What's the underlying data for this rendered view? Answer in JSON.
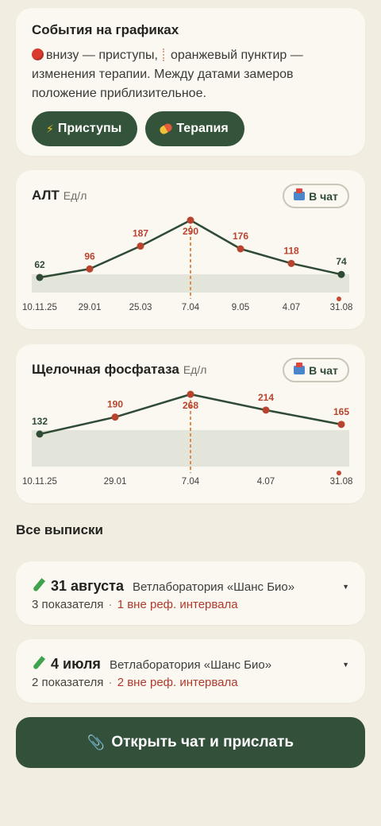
{
  "events": {
    "title": "События на графиках",
    "line1_a": "внизу — приступы,",
    "line1_b": "оранжевый пунктир —",
    "line2": "изменения терапии. Между датами замеров",
    "line3": "положение приблизительное.",
    "chips": [
      {
        "label": "Приступы",
        "icon": "lightning-icon"
      },
      {
        "label": "Терапия",
        "icon": "pill-icon"
      }
    ]
  },
  "chart_data": [
    {
      "type": "line",
      "title": "АЛТ",
      "unit": "Ед/л",
      "chat_label": "В чат",
      "x": [
        "10.11.25",
        "29.01",
        "25.03",
        "7.04",
        "9.05",
        "4.07",
        "31.08"
      ],
      "values": [
        62,
        96,
        187,
        290,
        176,
        118,
        74
      ],
      "ref_range_shaded": true,
      "therapy_change_at": "7.04",
      "seizure_marker_at": "31.08",
      "colors": {
        "line": "#2f4b36",
        "point_out_of_range": "#b8432f",
        "point_normal": "#2f4b36",
        "ref_band": "#e3e5da",
        "therapy_line": "#e08a4b"
      }
    },
    {
      "type": "line",
      "title": "Щелочная фосфатаза",
      "unit": "Ед/л",
      "chat_label": "В чат",
      "x": [
        "10.11.25",
        "29.01",
        "7.04",
        "4.07",
        "31.08"
      ],
      "values": [
        132,
        190,
        268,
        214,
        165
      ],
      "ref_range_shaded": true,
      "therapy_change_at": "7.04",
      "seizure_marker_at": "31.08",
      "colors": {
        "line": "#2f4b36",
        "point_out_of_range": "#b8432f",
        "point_normal": "#2f4b36",
        "ref_band": "#e3e5da",
        "therapy_line": "#e08a4b"
      }
    }
  ],
  "records": {
    "title": "Все выписки",
    "items": [
      {
        "date": "31 августа",
        "lab": "Ветлаборатория «Шанс Био»",
        "count": "3 показателя",
        "sep": "·",
        "bad": "1 вне реф. интервала"
      },
      {
        "date": "4 июля",
        "lab": "Ветлаборатория «Шанс Био»",
        "count": "2 показателя",
        "sep": "·",
        "bad": "2 вне реф. интервала"
      }
    ]
  },
  "open_chat": {
    "label": "Открыть чат и прислать",
    "icon": "paperclip-icon"
  }
}
